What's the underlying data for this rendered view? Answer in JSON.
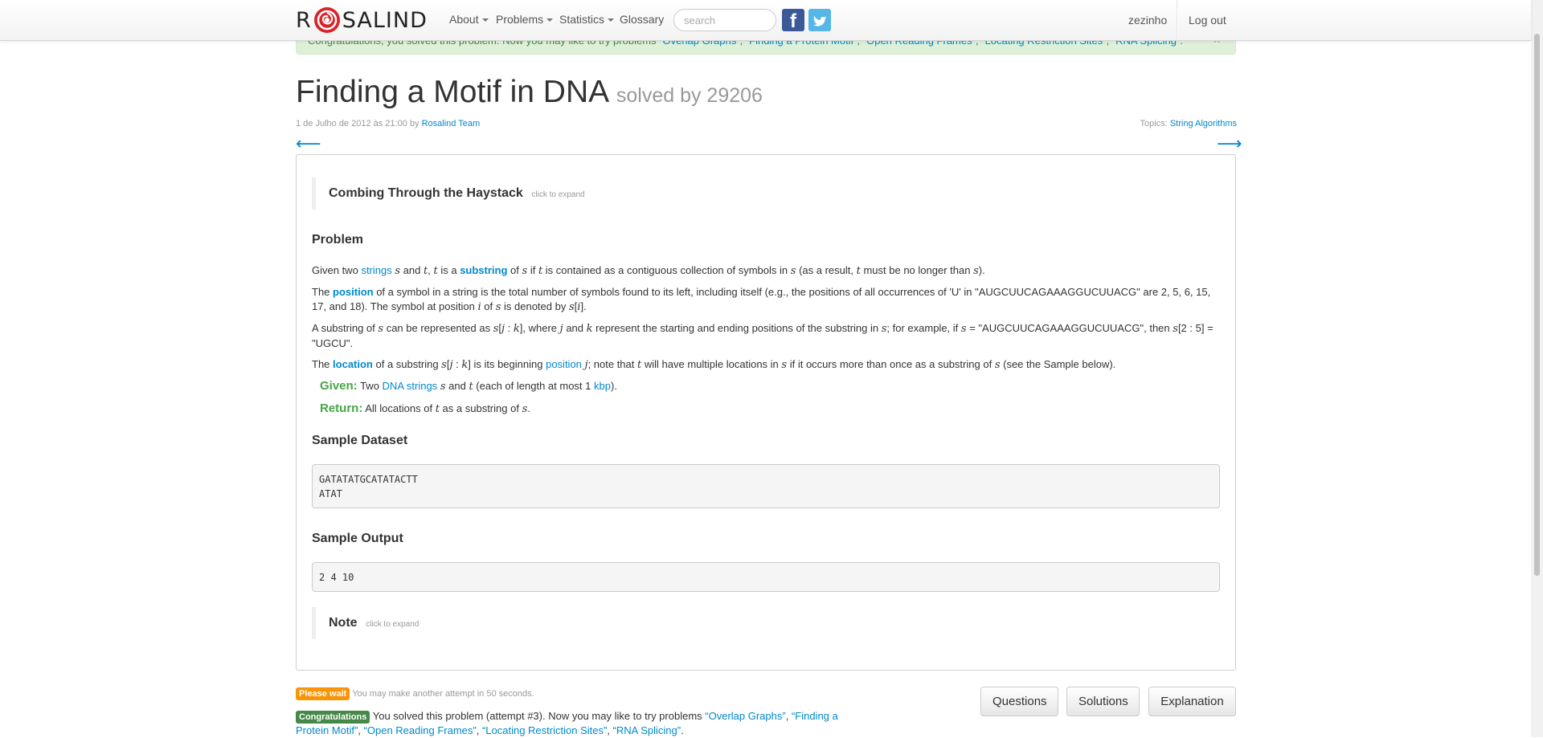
{
  "navbar": {
    "brand_left": "R",
    "brand_right": "SALIND",
    "items": [
      {
        "label": "About",
        "dropdown": true
      },
      {
        "label": "Problems",
        "dropdown": true
      },
      {
        "label": "Statistics",
        "dropdown": true
      },
      {
        "label": "Glossary",
        "dropdown": false
      }
    ],
    "search_placeholder": "search",
    "username": "zezinho",
    "logout": "Log out"
  },
  "alert": {
    "text": "Congratulations, you solved this problem. Now you may like to try problems",
    "problems": [
      "“Overlap Graphs”",
      "“Finding a Protein Motif”",
      "“Open Reading Frames”",
      "“Locating Restriction Sites”",
      "“RNA Splicing”"
    ],
    "close": "×"
  },
  "header": {
    "title": "Finding a Motif in DNA",
    "solved_by": "solved by 29206",
    "date_prefix": "1 de Julho de 2012 às 21:00 by",
    "author": "Rosalind Team",
    "topics_label": "Topics:",
    "topic": "String Algorithms",
    "prev_arrow": "⟵",
    "next_arrow": "⟶"
  },
  "problem": {
    "story_title": "Combing Through the Haystack",
    "expand_hint": "click to expand",
    "heading": "Problem",
    "p1": {
      "a": "Given two",
      "link1": "strings",
      "b": "and",
      "c": ",",
      "d": "is a",
      "link2": "substring",
      "e": "of",
      "f": "if",
      "g": "is contained as a contiguous collection of symbols in",
      "h": "(as a result,",
      "i": "must be no longer than",
      "j": ")."
    },
    "p2": {
      "a": "The",
      "link": "position",
      "b": "of a symbol in a string is the total number of symbols found to its left, including itself (e.g., the positions of all occurrences of 'U' in \"AUGCUUCAGAAAGGUCUUACG\" are 2, 5, 6, 15, 17, and 18). The symbol at position",
      "c": "of",
      "d": "is denoted by"
    },
    "p3": {
      "a": "A substring of",
      "b": "can be represented as",
      "c": ", where",
      "d": "and",
      "e": "represent the starting and ending positions of the substring in",
      "f": "; for example, if",
      "g": "= \"AUGCUUCAGAAAGGUCUUACG\", then",
      "h": "= \"UGCU\"."
    },
    "p4": {
      "a": "The",
      "link1": "location",
      "b": "of a substring",
      "c": "is its beginning",
      "link2": "position",
      "d": "; note that",
      "e": "will have multiple locations in",
      "f": "if it occurs more than once as a substring of",
      "g": "(see the Sample below)."
    },
    "given_label": "Given:",
    "given": {
      "a": "Two",
      "link": "DNA strings",
      "b": "and",
      "c": "(each of length at most 1",
      "link2": "kbp",
      "d": ")."
    },
    "return_label": "Return:",
    "return": {
      "a": "All locations of",
      "b": "as a substring of",
      "c": "."
    },
    "sample_dataset_heading": "Sample Dataset",
    "sample_dataset": "GATATATGCATATACTT\nATAT",
    "sample_output_heading": "Sample Output",
    "sample_output": "2 4 10",
    "note_title": "Note"
  },
  "footer": {
    "wait_badge": "Please wait",
    "wait_text": "You may make another attempt in 50 seconds.",
    "congrats_badge": "Congratulations",
    "congrats_text": "You solved this problem (attempt #3). Now you may like to try problems",
    "problems": [
      "“Overlap Graphs”",
      "“Finding a Protein Motif”",
      "“Open Reading Frames”",
      "“Locating Restriction Sites”",
      "“RNA Splicing”"
    ],
    "buttons": {
      "questions": "Questions",
      "solutions": "Solutions",
      "explanation": "Explanation"
    }
  },
  "colors": {
    "link": "#0088cc",
    "success": "#468847",
    "warning": "#f89406",
    "given": "#46a546"
  }
}
